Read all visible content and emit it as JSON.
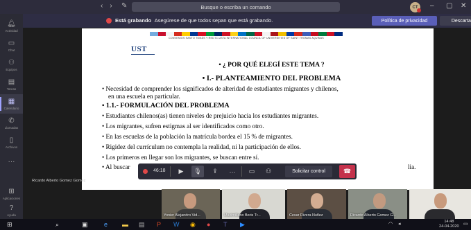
{
  "titlebar": {
    "search_placeholder": "Busque o escriba un comando",
    "avatar_initials": "CT"
  },
  "rail": {
    "items": [
      {
        "label": "Actividad",
        "icon": "bell-icon"
      },
      {
        "label": "Chat",
        "icon": "chat-icon"
      },
      {
        "label": "Equipos",
        "icon": "teams-icon"
      },
      {
        "label": "Tareas",
        "icon": "assignments-icon"
      },
      {
        "label": "Calendario",
        "icon": "calendar-icon"
      },
      {
        "label": "Llamadas",
        "icon": "phone-icon"
      },
      {
        "label": "Archivos",
        "icon": "files-icon"
      },
      {
        "label": "Aplicaciones",
        "icon": "apps-icon"
      },
      {
        "label": "Ayuda",
        "icon": "help-icon"
      }
    ]
  },
  "banner": {
    "title": "Está grabando",
    "message": "Asegúrese de que todos sepan que está grabando.",
    "privacy_button": "Política de privacidad",
    "dismiss_button": "Descartar"
  },
  "slide": {
    "flags_caption": "CONVENIOS SANTO TOMÁS Y RED IC-USTA INTERNATIONAL COUNCIL OF UNIVERSITIES OF SAINT THOMAS AQUINAS",
    "logo": "UST",
    "lines": [
      "•  ¿ POR QUÉ ELEGÍ ESTE TEMA ?",
      "•  I.- PLANTEAMIENTO DEL PROBLEMA",
      "•  Necesidad de comprender los significados de alteridad de estudiantes migrantes y chilenos,",
      "en una escuela en particular.",
      "•  1.1.- FORMULACIÓN DEL PROBLEMA",
      "•  Estudiantes chilenos(as) tienen niveles de prejuicio hacia los estudiantes migrantes.",
      "•  Los migrantes, sufren estigmas al ser identificados como otro.",
      "•  En las escuelas de la población la matrícula bordea el 15 % de migrantes.",
      "•  Rigidez del currículum no contempla la realidad, ni la participación de ellos.",
      "•  Los primeros en llegar son los migrantes, se buscan entre sí.",
      "•  Al buscar",
      "lia."
    ]
  },
  "presenter_name": "Ricardo Alberto Gomez Gomez",
  "controls": {
    "timer": "46:18",
    "share_request": "Solicitar control"
  },
  "participants": [
    {
      "name": "Yonier Alejandro Vid..."
    },
    {
      "name": "Maximiliano Boris Tr..."
    },
    {
      "name": "Cesar Rivera Nuñez"
    },
    {
      "name": "Ricardo Alberto Gomez G..."
    },
    {
      "name": ""
    }
  ],
  "taskbar": {
    "time": "14:48",
    "date": "24-04-2020"
  }
}
